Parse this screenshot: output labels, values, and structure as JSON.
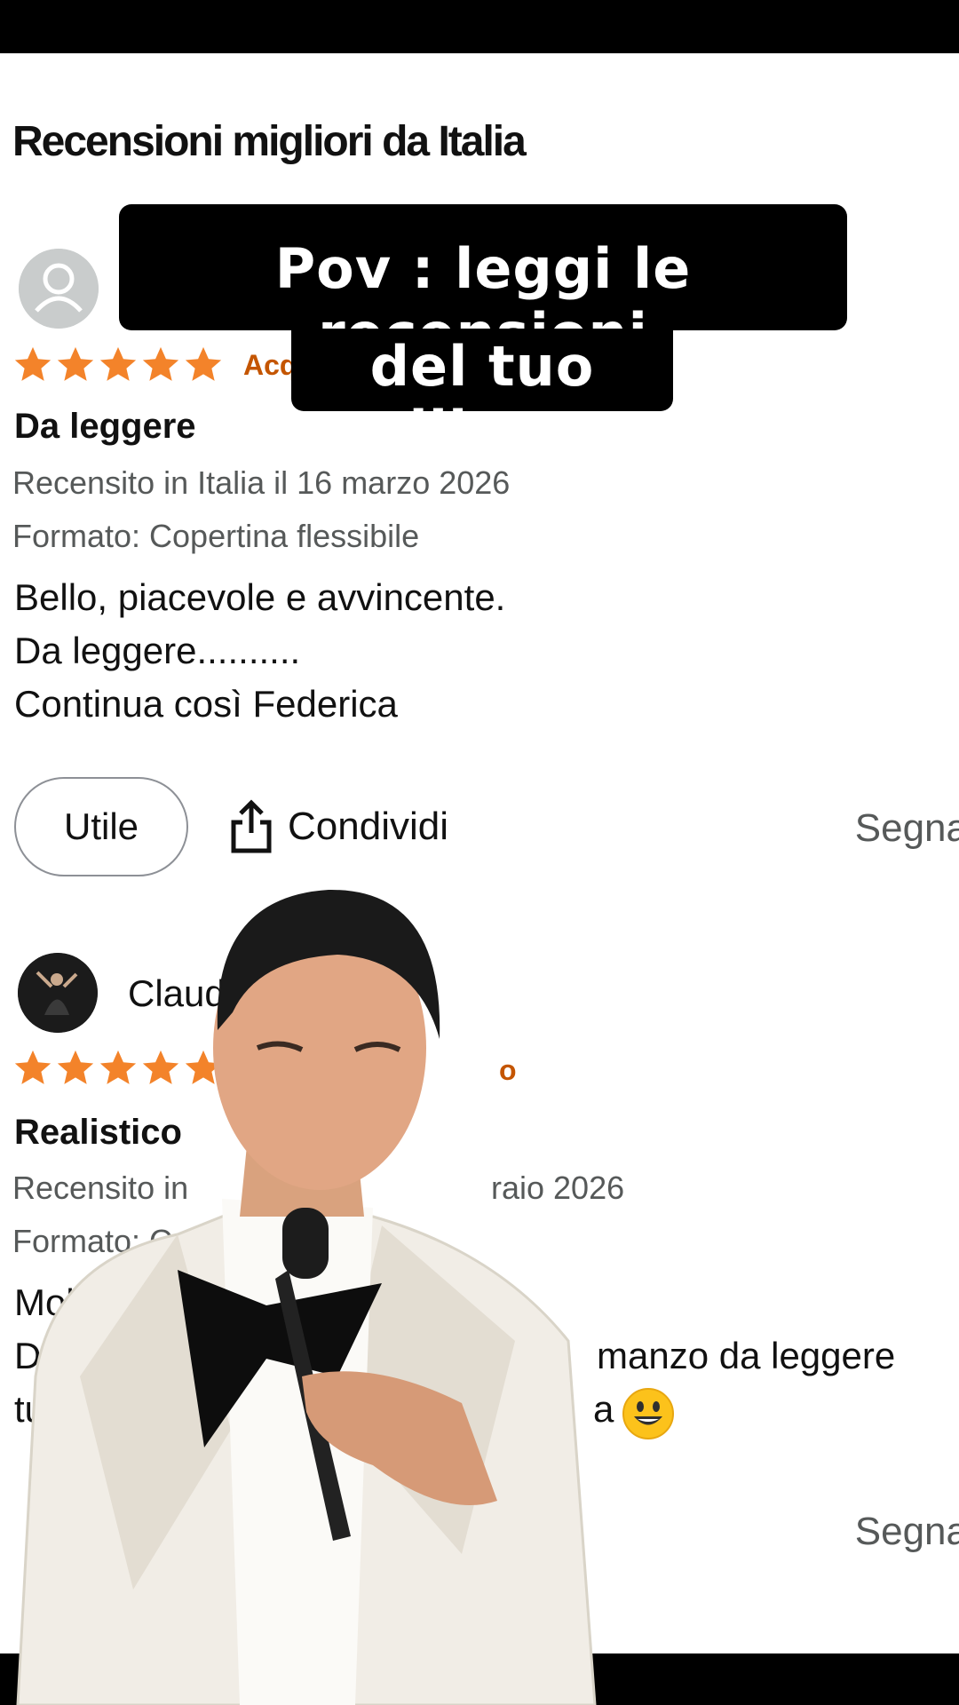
{
  "page": {
    "title": "Recensioni migliori da Italia"
  },
  "overlay": {
    "caption_line1": "Pov : leggi le recensioni",
    "caption_line2": "del tuo libro"
  },
  "colors": {
    "star": "#f3832a",
    "verified": "#c45500",
    "meta": "#565959"
  },
  "reviews": [
    {
      "author": "",
      "rating": 5,
      "verified_partial": "Acq",
      "title": "Da leggere",
      "date_line": "Recensito in Italia il 16 marzo 2026",
      "format_line": "Formato: Copertina flessibile",
      "body": "Bello, piacevole e avvincente.\nDa leggere..........\nContinua così Federica",
      "helpful_label": "Utile",
      "share_label": "Condividi",
      "report_label": "Segna"
    },
    {
      "author": "Claud",
      "rating": 5,
      "verified_partial": "o",
      "title": "Realistico",
      "date_line_left": "Recensito in",
      "date_line_right": "raio 2026",
      "format_line": "Formato: C",
      "body_line1": "Mol",
      "body_line2_left": "Du",
      "body_line2_right": "manzo da leggere",
      "body_line3_left": "tu",
      "body_line3_right": "a",
      "report_label": "Segna"
    }
  ],
  "icons": [
    "user-placeholder-icon",
    "star-icon",
    "share-icon",
    "smiley-emoji-icon"
  ]
}
